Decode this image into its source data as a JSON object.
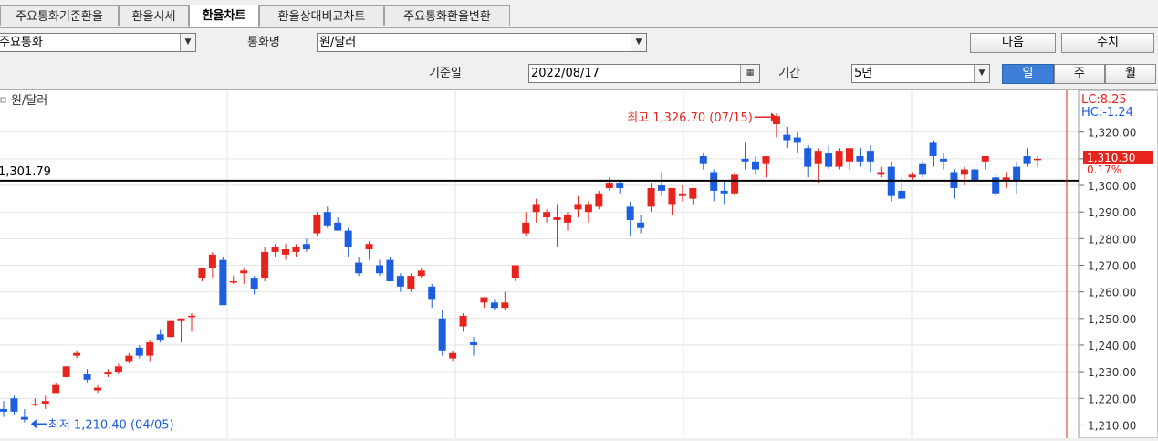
{
  "tabs": [
    {
      "label": "주요통화기준환율",
      "active": false
    },
    {
      "label": "환율시세",
      "active": false
    },
    {
      "label": "환율차트",
      "active": true
    },
    {
      "label": "환율상대비교차트",
      "active": false
    },
    {
      "label": "주요통화환율변환",
      "active": false
    }
  ],
  "toolbar": {
    "category_value": "주요통화",
    "currency_label": "통화명",
    "currency_value": "원/달러",
    "next_label": "다음",
    "values_label": "수치",
    "base_date_label": "기준일",
    "base_date_value": "2022/08/17",
    "period_label": "기간",
    "period_value": "5년",
    "freq_buttons": [
      {
        "label": "일",
        "selected": true
      },
      {
        "label": "주",
        "selected": false
      },
      {
        "label": "월",
        "selected": false
      }
    ]
  },
  "colors": {
    "up": "#e8231d",
    "down": "#1d5ee0",
    "accent": "#3d7fd8",
    "line": "#000000",
    "vline": "#e8231d"
  },
  "chart_data": {
    "type": "candlestick",
    "legend": "원/달러",
    "ylim": [
      1205,
      1335
    ],
    "yticks": [
      "1,320.00",
      "1,310.00",
      "1,300.00",
      "1,290.00",
      "1,280.00",
      "1,270.00",
      "1,260.00",
      "1,250.00",
      "1,240.00",
      "1,230.00",
      "1,220.00",
      "1,210.00"
    ],
    "ytick_values": [
      1320,
      1310,
      1300,
      1290,
      1280,
      1270,
      1260,
      1250,
      1240,
      1230,
      1220,
      1210
    ],
    "reference_line": {
      "value": 1301.79,
      "label": "1,301.79"
    },
    "max_annotation": {
      "text": "최고 1,326.70 (07/15)",
      "value": 1326.7
    },
    "min_annotation": {
      "text": "최저 1,210.40 (04/05)",
      "value": 1210.4
    },
    "current": {
      "price": "1,310.30",
      "change": "0.17%",
      "lc": "LC:8.25",
      "hc": "HC:-1.24"
    },
    "candles": [
      [
        1216,
        1219,
        1213,
        1215
      ],
      [
        1220,
        1221,
        1214,
        1215
      ],
      [
        1213,
        1216,
        1211,
        1212
      ],
      [
        1218,
        1220,
        1217,
        1218
      ],
      [
        1218,
        1221,
        1216,
        1219
      ],
      [
        1222,
        1226,
        1222,
        1225
      ],
      [
        1228,
        1232,
        1228,
        1232
      ],
      [
        1236,
        1238,
        1235,
        1237
      ],
      [
        1229,
        1231,
        1226,
        1227
      ],
      [
        1223,
        1225,
        1222,
        1224
      ],
      [
        1229,
        1231,
        1228,
        1230
      ],
      [
        1230,
        1233,
        1229,
        1232
      ],
      [
        1234,
        1237,
        1233,
        1236
      ],
      [
        1239,
        1240,
        1235,
        1236
      ],
      [
        1236,
        1242,
        1234,
        1241
      ],
      [
        1244,
        1246,
        1241,
        1242
      ],
      [
        1243,
        1249,
        1243,
        1249
      ],
      [
        1249,
        1250,
        1241,
        1250
      ],
      [
        1251,
        1252,
        1245,
        1251
      ],
      [
        1265,
        1269,
        1264,
        1269
      ],
      [
        1269,
        1275,
        1265,
        1274
      ],
      [
        1272,
        1273,
        1255,
        1255
      ],
      [
        1264,
        1266,
        1263,
        1264
      ],
      [
        1267,
        1269,
        1263,
        1268
      ],
      [
        1265,
        1266,
        1259,
        1261
      ],
      [
        1265,
        1277,
        1264,
        1275
      ],
      [
        1275,
        1278,
        1273,
        1277
      ],
      [
        1274,
        1278,
        1272,
        1276
      ],
      [
        1275,
        1278,
        1273,
        1277
      ],
      [
        1278,
        1280,
        1275,
        1276
      ],
      [
        1282,
        1290,
        1281,
        1289
      ],
      [
        1290,
        1292,
        1284,
        1285
      ],
      [
        1286,
        1288,
        1283,
        1283
      ],
      [
        1283,
        1284,
        1273,
        1277
      ],
      [
        1271,
        1273,
        1266,
        1267
      ],
      [
        1276,
        1279,
        1272,
        1278
      ],
      [
        1270,
        1272,
        1266,
        1267
      ],
      [
        1272,
        1273,
        1264,
        1264
      ],
      [
        1266,
        1267,
        1260,
        1262
      ],
      [
        1261,
        1267,
        1260,
        1266
      ],
      [
        1266,
        1269,
        1265,
        1268
      ],
      [
        1262,
        1263,
        1254,
        1257
      ],
      [
        1250,
        1253,
        1236,
        1238
      ],
      [
        1235,
        1238,
        1234,
        1237
      ],
      [
        1247,
        1252,
        1245,
        1251
      ],
      [
        1241,
        1243,
        1236,
        1240
      ],
      [
        1256,
        1258,
        1254,
        1258
      ],
      [
        1256,
        1257,
        1253,
        1254
      ],
      [
        1254,
        1260,
        1253,
        1256
      ],
      [
        1265,
        1270,
        1264,
        1270
      ],
      [
        1282,
        1290,
        1281,
        1286
      ],
      [
        1290,
        1295,
        1286,
        1293
      ],
      [
        1288,
        1291,
        1286,
        1290
      ],
      [
        1287,
        1293,
        1277,
        1288
      ],
      [
        1286,
        1290,
        1283,
        1289
      ],
      [
        1291,
        1296,
        1288,
        1293
      ],
      [
        1290,
        1294,
        1286,
        1293
      ],
      [
        1292,
        1298,
        1291,
        1297
      ],
      [
        1299,
        1303,
        1298,
        1301
      ],
      [
        1301,
        1302,
        1297,
        1299
      ],
      [
        1292,
        1294,
        1281,
        1287
      ],
      [
        1286,
        1289,
        1282,
        1284
      ],
      [
        1292,
        1301,
        1290,
        1299
      ],
      [
        1300,
        1305,
        1296,
        1298
      ],
      [
        1293,
        1298,
        1289,
        1299
      ],
      [
        1296,
        1300,
        1294,
        1297
      ],
      [
        1295,
        1299,
        1293,
        1299
      ],
      [
        1311,
        1312,
        1306,
        1308
      ],
      [
        1305,
        1306,
        1294,
        1298
      ],
      [
        1298,
        1302,
        1293,
        1297
      ],
      [
        1297,
        1305,
        1296,
        1304
      ],
      [
        1310,
        1316,
        1306,
        1309
      ],
      [
        1309,
        1311,
        1304,
        1306
      ],
      [
        1308,
        1310,
        1303,
        1311
      ],
      [
        1323,
        1327,
        1318,
        1326
      ],
      [
        1319,
        1322,
        1314,
        1317
      ],
      [
        1318,
        1320,
        1312,
        1316
      ],
      [
        1314,
        1315,
        1303,
        1307
      ],
      [
        1308,
        1314,
        1301,
        1313
      ],
      [
        1312,
        1315,
        1306,
        1307
      ],
      [
        1307,
        1314,
        1306,
        1313
      ],
      [
        1309,
        1314,
        1306,
        1314
      ],
      [
        1311,
        1314,
        1307,
        1309
      ],
      [
        1313,
        1315,
        1305,
        1309
      ],
      [
        1304,
        1307,
        1303,
        1305
      ],
      [
        1307,
        1309,
        1294,
        1296
      ],
      [
        1298,
        1303,
        1295,
        1295
      ],
      [
        1303,
        1305,
        1302,
        1304
      ],
      [
        1308,
        1309,
        1303,
        1304
      ],
      [
        1316,
        1317,
        1307,
        1311
      ],
      [
        1310,
        1312,
        1306,
        1309
      ],
      [
        1305,
        1306,
        1295,
        1299
      ],
      [
        1304,
        1307,
        1300,
        1306
      ],
      [
        1306,
        1307,
        1301,
        1302
      ],
      [
        1309,
        1311,
        1306,
        1311
      ],
      [
        1303,
        1304,
        1296,
        1297
      ],
      [
        1302,
        1305,
        1299,
        1303
      ],
      [
        1307,
        1309,
        1297,
        1302
      ],
      [
        1311,
        1314,
        1307,
        1308
      ],
      [
        1310,
        1311,
        1307,
        1310
      ]
    ]
  }
}
